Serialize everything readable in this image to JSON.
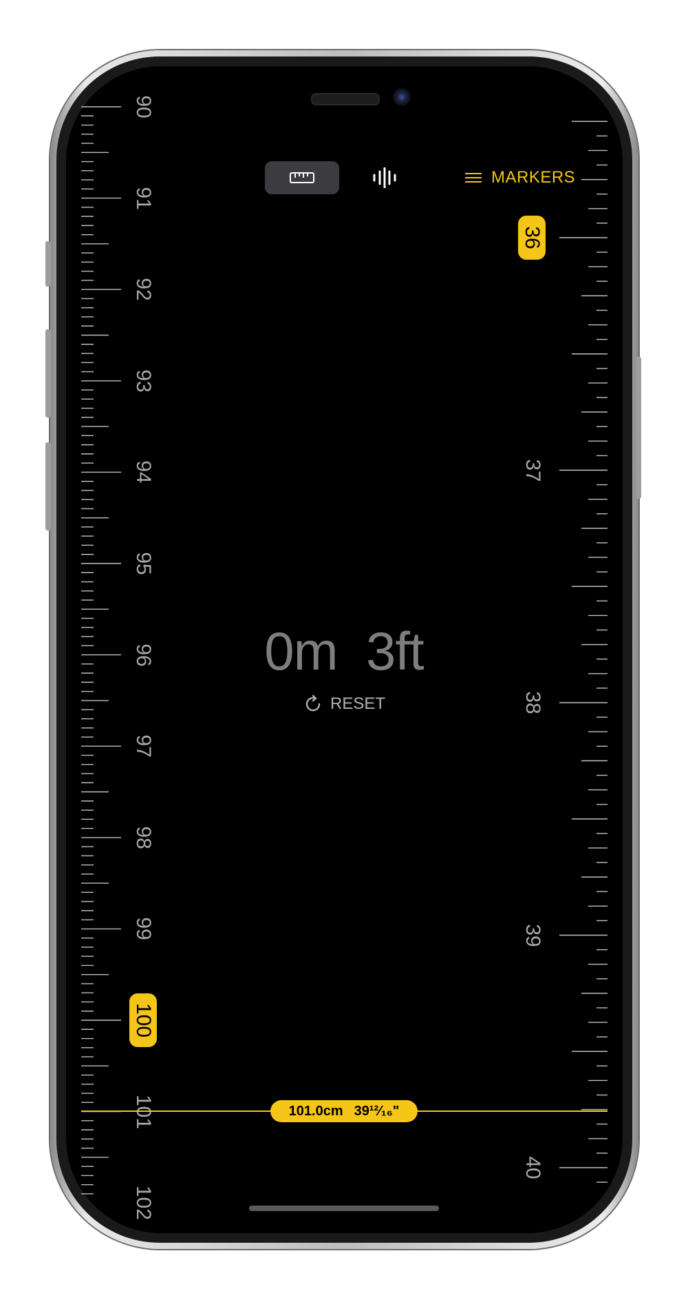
{
  "left_ruler": {
    "labels": [
      "90",
      "91",
      "92",
      "93",
      "94",
      "95",
      "96",
      "97",
      "98",
      "99",
      "100",
      "101",
      "102"
    ],
    "highlighted": "100"
  },
  "right_ruler": {
    "labels": [
      "36",
      "37",
      "38",
      "39",
      "40"
    ],
    "highlighted": "36"
  },
  "toolbar": {
    "ruler_mode_icon": "ruler-icon",
    "level_mode_icon": "waveform-icon",
    "markers_label": "MARKERS",
    "markers_icon": "hamburger-icon"
  },
  "readout": {
    "meters": "0m",
    "feet": "3ft"
  },
  "reset_label": "RESET",
  "measurement": {
    "cm": "101.0cm",
    "inches": "39¹²⁄₁₆\""
  },
  "colors": {
    "accent": "#f5c518",
    "background": "#000000",
    "tick": "#bfbfbf",
    "active_mode_bg": "#3b3b40"
  }
}
